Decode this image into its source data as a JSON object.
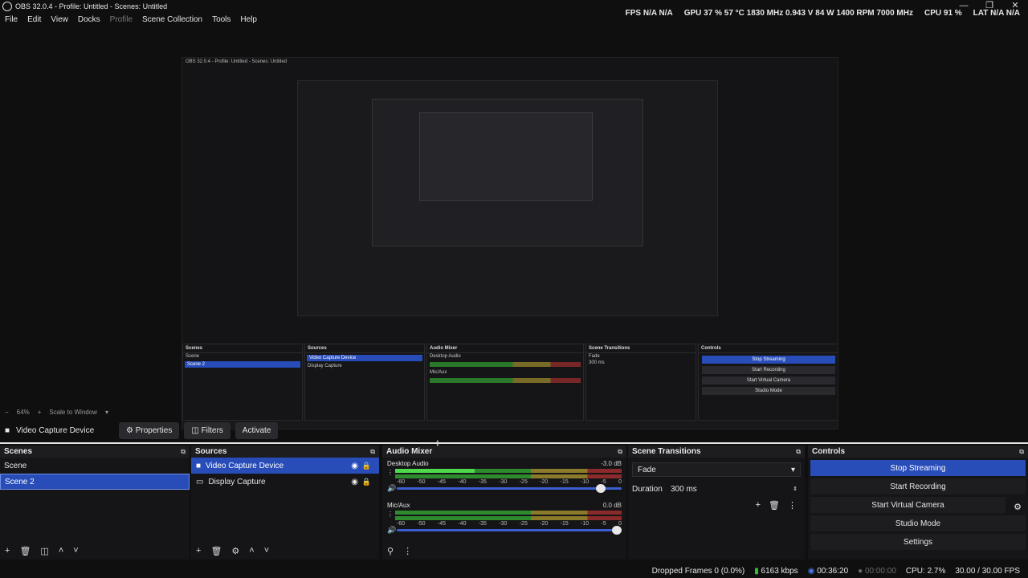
{
  "window": {
    "title": "OBS 32.0.4 - Profile: Untitled - Scenes: Untitled",
    "controls": [
      "—",
      "❐",
      "✕"
    ]
  },
  "menu": [
    "File",
    "Edit",
    "View",
    "Docks",
    "Profile",
    "Scene Collection",
    "Tools",
    "Help"
  ],
  "stats": {
    "fps": "FPS  N/A  N/A",
    "gpu": "GPU  37 %  57 °C  1830 MHz  0.943 V  84 W  1400 RPM  7000 MHz",
    "cpu": "CPU  91 %",
    "lat": "LAT  N/A  N/A"
  },
  "zoom": {
    "minus": "−",
    "value": "64%",
    "plus": "+",
    "scale": "Scale to Window"
  },
  "source_bar": {
    "source": "Video Capture Device",
    "properties": "Properties",
    "filters": "Filters",
    "activate": "Activate"
  },
  "scenes": {
    "title": "Scenes",
    "items": [
      "Scene",
      "Scene 2"
    ],
    "selected": 1
  },
  "sources": {
    "title": "Sources",
    "items": [
      "Video Capture Device",
      "Display Capture"
    ],
    "selected": 0
  },
  "mixer": {
    "title": "Audio Mixer",
    "scale": [
      "-60",
      "-50",
      "-45",
      "-40",
      "-35",
      "-30",
      "-25",
      "-20",
      "-15",
      "-10",
      "-5",
      "0"
    ],
    "channels": [
      {
        "name": "Desktop Audio",
        "db": "-3.0 dB",
        "level": 0.35,
        "fader": 0.93
      },
      {
        "name": "Mic/Aux",
        "db": "0.0 dB",
        "level": 0,
        "fader": 1.0
      }
    ]
  },
  "transitions": {
    "title": "Scene Transitions",
    "selected": "Fade",
    "duration_label": "Duration",
    "duration": "300 ms"
  },
  "controls": {
    "title": "Controls",
    "stop_streaming": "Stop Streaming",
    "start_recording": "Start Recording",
    "virtual_camera": "Start Virtual Camera",
    "studio_mode": "Studio Mode",
    "settings": "Settings"
  },
  "status": {
    "dropped": "Dropped Frames 0 (0.0%)",
    "bitrate": "6163 kbps",
    "stream_time": "00:36:20",
    "rec_time": "00:00:00",
    "cpu": "CPU: 2.7%",
    "fps": "30.00 / 30.00 FPS"
  },
  "colors": {
    "accent": "#284cb8",
    "background": "#0f0f10",
    "panel": "#151517"
  }
}
